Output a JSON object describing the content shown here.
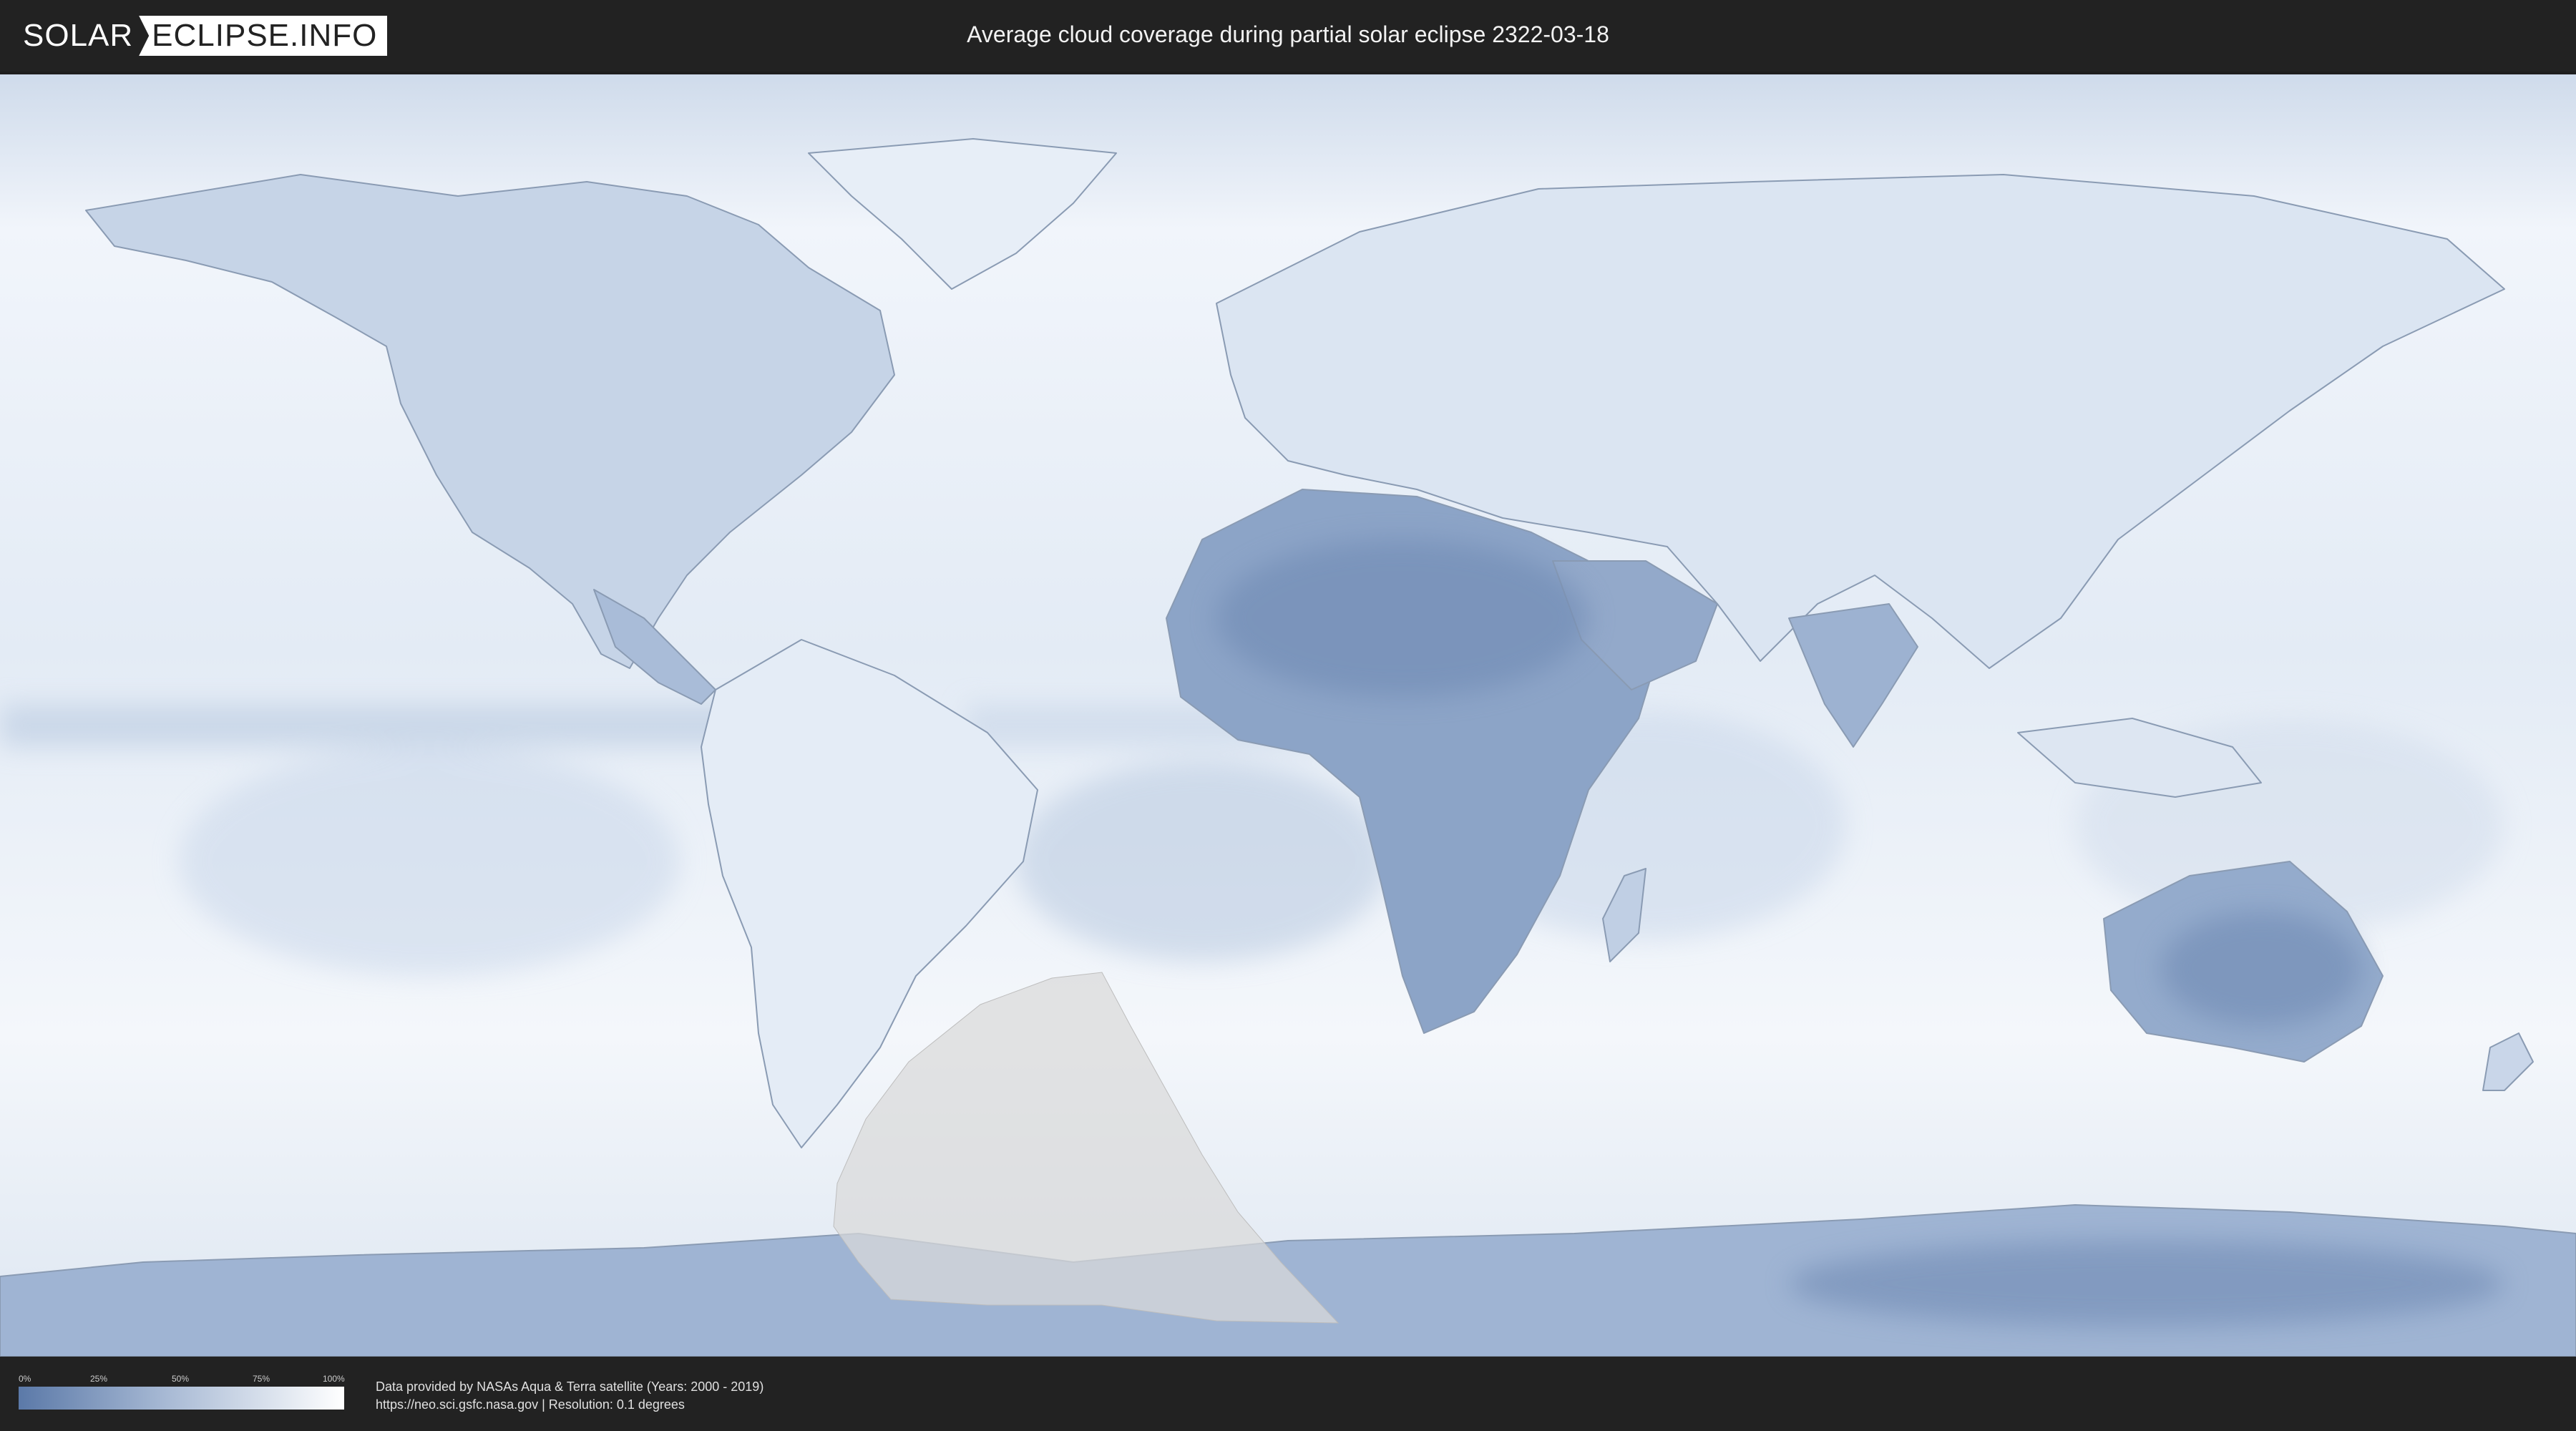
{
  "header": {
    "logo_part1": "SOLAR",
    "logo_part2": "ECLIPSE.INFO",
    "title": "Average cloud coverage during partial solar eclipse 2322-03-18"
  },
  "map": {
    "ocean_cloud_color": "#eaf0f8",
    "clear_sky_color": "#5b79a8",
    "land_border_color": "#8a9bb3",
    "eclipse_zone_color": "#d9d9d9"
  },
  "legend": {
    "ticks": [
      "0%",
      "25%",
      "50%",
      "75%",
      "100%"
    ],
    "gradient_start": "#5b79a8",
    "gradient_end": "#ffffff"
  },
  "credits": {
    "line1": "Data provided by NASAs Aqua & Terra satellite (Years: 2000 - 2019)",
    "line2": "https://neo.sci.gsfc.nasa.gov | Resolution: 0.1 degrees"
  }
}
